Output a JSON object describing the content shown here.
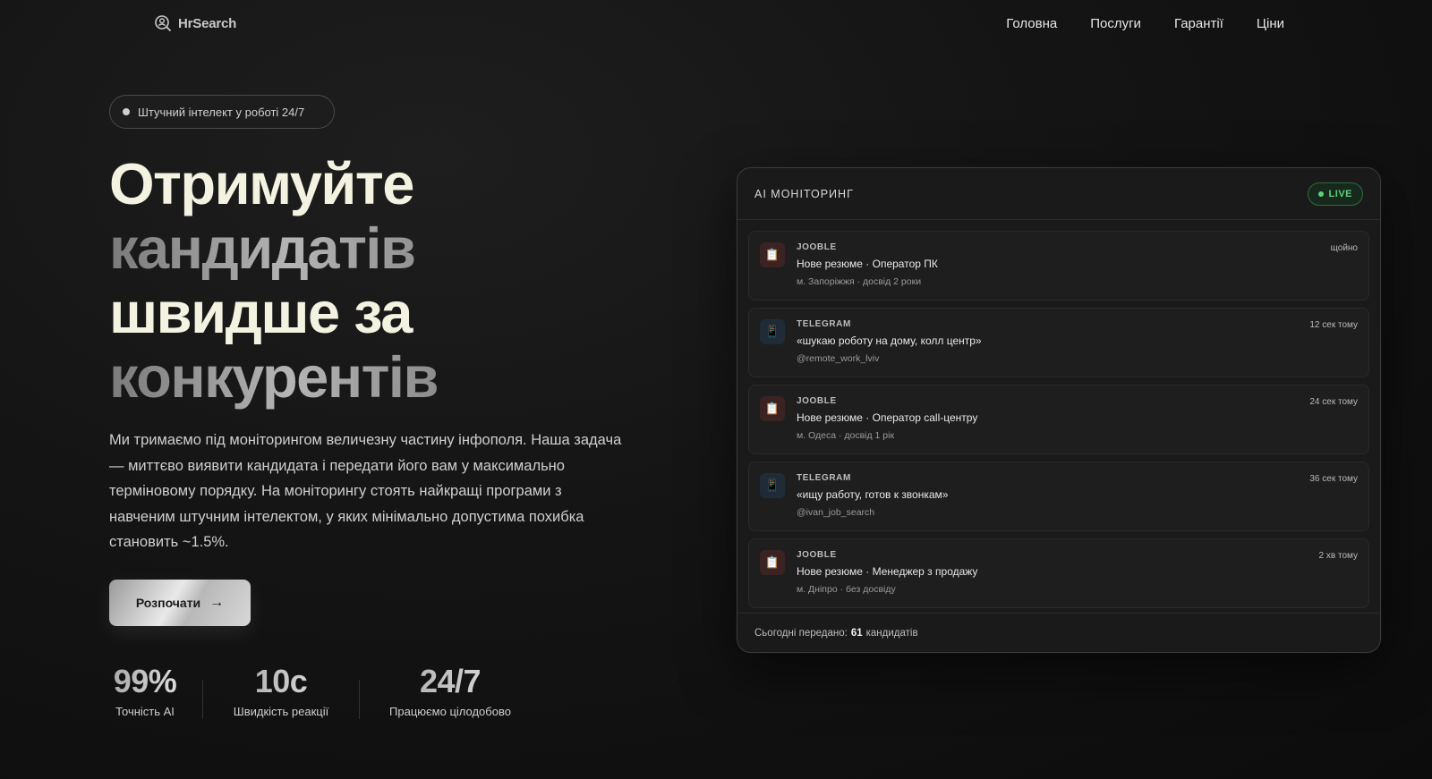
{
  "header": {
    "logo_text": "HrSearch",
    "nav": [
      "Головна",
      "Послуги",
      "Гарантії",
      "Ціни"
    ]
  },
  "hero": {
    "badge": "Штучний інтелект у роботі 24/7",
    "headline": [
      "Отримуйте",
      "кандидатів",
      "швидше за",
      "конкурентів"
    ],
    "description": "Ми тримаємо під моніторингом величезну частину інфополя. Наша задача — миттєво виявити кандидата і передати його вам у максимально терміновому порядку. На моніторингу стоять найкращі програми з навченим штучним інтелектом, у яких мінімально допустима похибка становить ~1.5%.",
    "cta_label": "Розпочати",
    "stats": [
      {
        "value": "99%",
        "label": "Точність AI"
      },
      {
        "value": "10с",
        "label": "Швидкість реакції"
      },
      {
        "value": "24/7",
        "label": "Працюємо цілодобово"
      }
    ]
  },
  "panel": {
    "title": "AI МОНІТОРИНГ",
    "live_label": "LIVE",
    "items": [
      {
        "source": "JOOBLE",
        "icon": "clipboard-icon",
        "time": "щойно",
        "title": "Нове резюме · Оператор ПК",
        "meta": "м. Запоріжжя · досвід 2 роки"
      },
      {
        "source": "TELEGRAM",
        "icon": "phone-icon",
        "time": "12 сек тому",
        "title": "«шукаю роботу на дому, колл центр»",
        "meta": "@remote_work_lviv"
      },
      {
        "source": "JOOBLE",
        "icon": "clipboard-icon",
        "time": "24 сек тому",
        "title": "Нове резюме · Оператор call-центру",
        "meta": "м. Одеса · досвід 1 рік"
      },
      {
        "source": "TELEGRAM",
        "icon": "phone-icon",
        "time": "36 сек тому",
        "title": "«ищу работу, готов к звонкам»",
        "meta": "@ivan_job_search"
      },
      {
        "source": "JOOBLE",
        "icon": "clipboard-icon",
        "time": "2 хв тому",
        "title": "Нове резюме · Менеджер з продажу",
        "meta": "м. Дніпро · без досвіду"
      }
    ],
    "footer_prefix": "Сьогодні передано:",
    "footer_count": "61",
    "footer_suffix": "кандидатів"
  },
  "colors": {
    "background": "#121212",
    "headline_light": "#f4f2e0",
    "live_green": "#5fd17a"
  }
}
